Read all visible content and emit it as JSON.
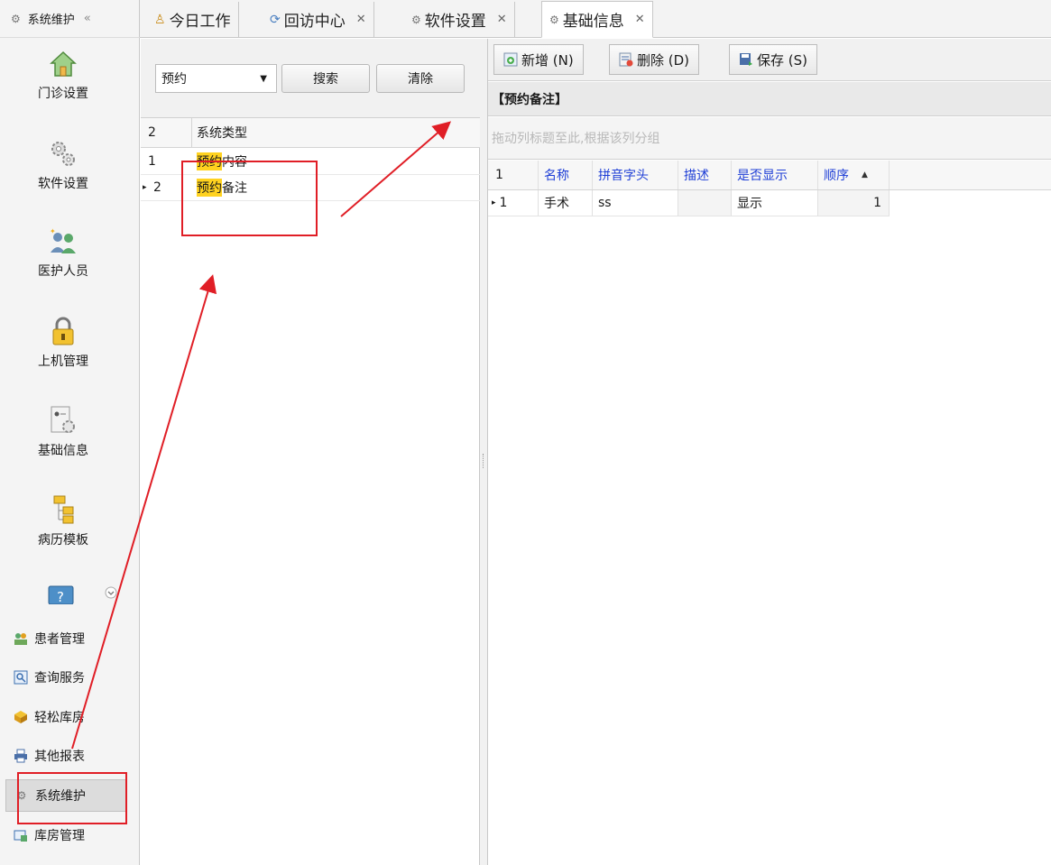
{
  "sidebar": {
    "header_title": "系统维护",
    "collapse_glyph": "«",
    "big_items": [
      {
        "label": "门诊设置",
        "icon": "house-icon"
      },
      {
        "label": "软件设置",
        "icon": "gears-icon"
      },
      {
        "label": "医护人员",
        "icon": "users-icon"
      },
      {
        "label": "上机管理",
        "icon": "lock-icon"
      },
      {
        "label": "基础信息",
        "icon": "info-settings-icon"
      },
      {
        "label": "病历模板",
        "icon": "tree-icon"
      }
    ],
    "small_items": [
      {
        "label": "患者管理",
        "icon": "patients-icon"
      },
      {
        "label": "查询服务",
        "icon": "query-icon"
      },
      {
        "label": "轻松库房",
        "icon": "box-icon"
      },
      {
        "label": "其他报表",
        "icon": "printer-icon"
      },
      {
        "label": "系统维护",
        "icon": "gear-icon"
      },
      {
        "label": "库房管理",
        "icon": "warehouse-icon"
      }
    ]
  },
  "tabs": [
    {
      "label": "今日工作",
      "closable": false
    },
    {
      "label": "回访中心",
      "closable": true
    },
    {
      "label": "软件设置",
      "closable": true
    },
    {
      "label": "基础信息",
      "closable": true
    }
  ],
  "left": {
    "filter_value": "预约",
    "search_label": "搜索",
    "clear_label": "清除",
    "grid": {
      "count": "2",
      "column": "系统类型",
      "rows": [
        {
          "index": "1",
          "highlight": "预约",
          "rest": "内容",
          "marker": ""
        },
        {
          "index": "2",
          "highlight": "预约",
          "rest": "备注",
          "marker": "▸"
        }
      ]
    }
  },
  "right": {
    "toolbar": {
      "add_label": "新增 (N)",
      "delete_label": "删除 (D)",
      "save_label": "保存 (S)"
    },
    "section_title": "【预约备注】",
    "group_hint": "拖动列标题至此,根据该列分组",
    "grid": {
      "count": "1",
      "columns": [
        "名称",
        "拼音字头",
        "描述",
        "是否显示",
        "顺序"
      ],
      "sort_glyph": "▲",
      "row": {
        "marker": "▸",
        "index": "1",
        "name": "手术",
        "pinyin": "ss",
        "desc": "",
        "show": "显示",
        "order": "1"
      }
    }
  },
  "colors": {
    "highlight": "#ffd21f",
    "annotation": "#e01e26",
    "header_text": "#1f3fd6"
  }
}
